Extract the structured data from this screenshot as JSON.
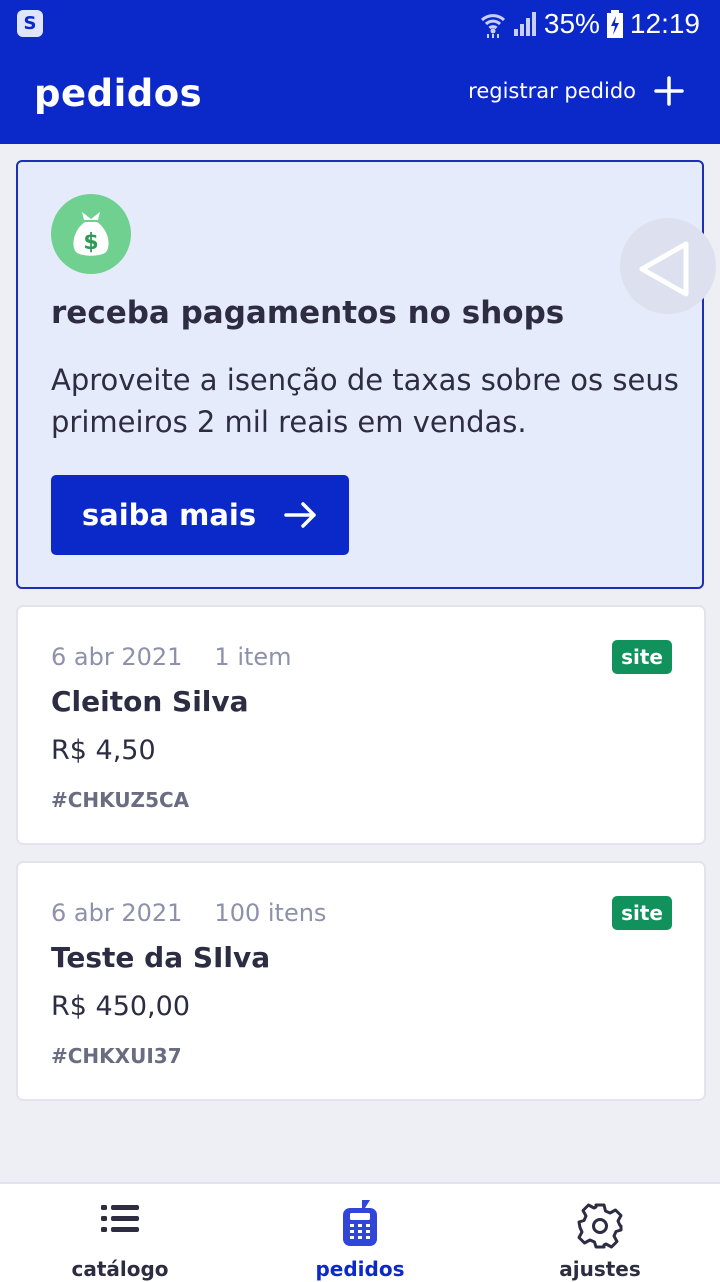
{
  "status_bar": {
    "app_badge": "S",
    "battery": "35%",
    "time": "12:19"
  },
  "header": {
    "title": "pedidos",
    "action_label": "registrar pedido",
    "action_icon": "plus-icon"
  },
  "promo": {
    "icon": "money-bag-icon",
    "title": "receba pagamentos no shops",
    "text": "Aproveite a isenção de taxas sobre os seus primeiros 2 mil reais em vendas.",
    "button_label": "saiba mais",
    "button_icon": "arrow-right-icon"
  },
  "orders": [
    {
      "date": "6 abr 2021",
      "items": "1 item",
      "badge": "site",
      "customer": "Cleiton Silva",
      "total": "R$ 4,50",
      "code": "#CHKUZ5CA"
    },
    {
      "date": "6 abr 2021",
      "items": "100 itens",
      "badge": "site",
      "customer": "Teste da SIlva",
      "total": "R$ 450,00",
      "code": "#CHKXUI37"
    }
  ],
  "bottom_nav": [
    {
      "label": "catálogo",
      "icon": "list-icon",
      "active": false
    },
    {
      "label": "pedidos",
      "icon": "register-icon",
      "active": true
    },
    {
      "label": "ajustes",
      "icon": "gear-icon",
      "active": false
    }
  ],
  "colors": {
    "primary": "#0b29c8",
    "badge_green": "#11915c",
    "promo_bg": "#e6ebfb",
    "page_bg": "#eeeef5"
  }
}
